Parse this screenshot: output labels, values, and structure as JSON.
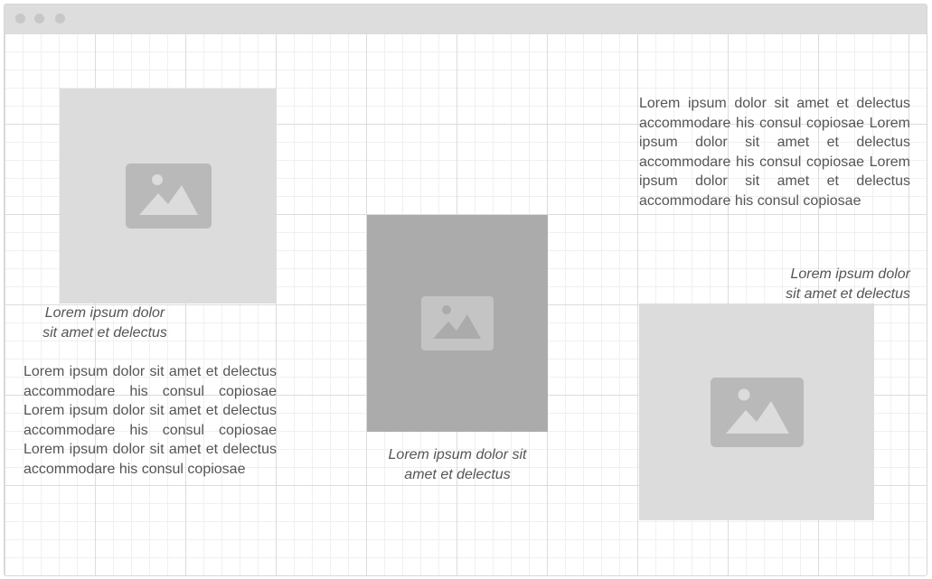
{
  "window": {
    "titlebar_dots": [
      "dot",
      "dot",
      "dot"
    ]
  },
  "icons": {
    "placeholder": "image-icon"
  },
  "colors": {
    "placeholder_light": "#dcdcdc",
    "placeholder_dark": "#ababab",
    "icon_on_light": "#b9b9b9",
    "icon_on_dark": "#c4c4c4",
    "text": "#555555"
  },
  "col1": {
    "caption_line1": "Lorem ipsum dolor",
    "caption_line2": "sit amet et delectus",
    "body": "Lorem ipsum dolor sit amet et delectus accommodare his consul copiosae Lorem ipsum dolor sit amet et delectus accommodare his consul copiosae Lorem ipsum dolor sit amet et delectus accommodare his consul copiosae"
  },
  "col2": {
    "caption_line1": "Lorem ipsum dolor sit",
    "caption_line2": "amet et delectus"
  },
  "col3": {
    "body": "Lorem ipsum dolor sit amet et delectus accommodare his consul copiosae Lorem ipsum dolor sit amet et delectus accommodare his consul copiosae Lorem ipsum dolor sit amet et delectus accommodare his consul copiosae",
    "caption_line1": "Lorem ipsum dolor",
    "caption_line2": "sit amet et delectus"
  }
}
